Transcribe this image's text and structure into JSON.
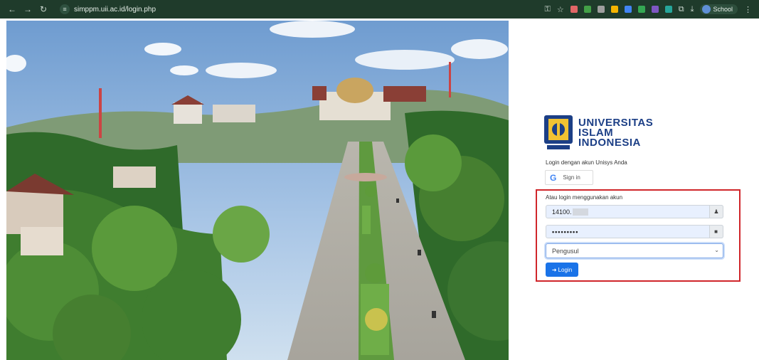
{
  "browser": {
    "url": "simppm.uii.ac.id/login.php",
    "profile_label": "School",
    "icons": [
      "back-icon",
      "forward-icon",
      "reload-icon",
      "site-info-icon",
      "password-key-icon",
      "bookmark-star-icon",
      "extensions-icon",
      "download-icon",
      "menu-icon"
    ]
  },
  "brand": {
    "line1": "UNIVERSITAS",
    "line2": "ISLAM",
    "line3": "INDONESIA",
    "color": "#1c3f86"
  },
  "login": {
    "subtitle": "Login dengan akun Unisys Anda",
    "google_button": "Sign in",
    "alt_label": "Atau login menggunakan akun",
    "username_value": "14100.",
    "password_value": "•••••••••",
    "role_selected": "Pengusul",
    "submit_label": "Login",
    "highlight_color": "#d0262b",
    "button_color": "#1a73e8"
  }
}
